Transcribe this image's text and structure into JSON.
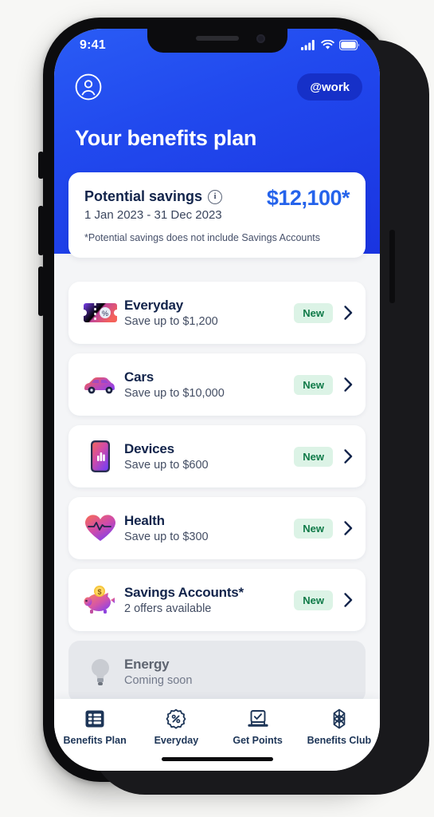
{
  "status_bar": {
    "time": "9:41",
    "signal_icon": "cellular-signal-icon",
    "wifi_icon": "wifi-icon",
    "battery_icon": "battery-icon"
  },
  "header": {
    "avatar_icon": "profile-avatar-icon",
    "workspace_badge": "@work",
    "title": "Your benefits plan",
    "background_color": "#2149ee"
  },
  "savings_card": {
    "label": "Potential savings",
    "info_icon": "info-icon",
    "amount": "$12,100*",
    "amount_color": "#2563eb",
    "date_range": "1 Jan 2023  -  31 Dec 2023",
    "disclaimer": "*Potential savings does not include Savings Accounts"
  },
  "benefits": [
    {
      "icon": "coupon-ticket-icon",
      "title": "Everyday",
      "subtitle": "Save up to $1,200",
      "badge": "New",
      "chevron_icon": "chevron-right-icon",
      "disabled": false
    },
    {
      "icon": "car-icon",
      "title": "Cars",
      "subtitle": "Save up to $10,000",
      "badge": "New",
      "chevron_icon": "chevron-right-icon",
      "disabled": false
    },
    {
      "icon": "mobile-phone-icon",
      "title": "Devices",
      "subtitle": "Save up to $600",
      "badge": "New",
      "chevron_icon": "chevron-right-icon",
      "disabled": false
    },
    {
      "icon": "heart-pulse-icon",
      "title": "Health",
      "subtitle": "Save up to $300",
      "badge": "New",
      "chevron_icon": "chevron-right-icon",
      "disabled": false
    },
    {
      "icon": "piggy-bank-icon",
      "title": "Savings Accounts*",
      "subtitle": "2 offers available",
      "badge": "New",
      "chevron_icon": "chevron-right-icon",
      "disabled": false
    },
    {
      "icon": "lightbulb-icon",
      "title": "Energy",
      "subtitle": "Coming soon",
      "badge": "",
      "chevron_icon": "",
      "disabled": true
    }
  ],
  "badge_colors": {
    "background": "#dcf3e6",
    "text": "#0f7a48"
  },
  "tabbar": {
    "active_index": 0,
    "tabs": [
      {
        "label": "Benefits Plan",
        "icon": "list-grid-icon"
      },
      {
        "label": "Everyday",
        "icon": "percent-badge-icon"
      },
      {
        "label": "Get Points",
        "icon": "laptop-check-icon"
      },
      {
        "label": "Benefits Club",
        "icon": "snowflake-icon"
      }
    ]
  }
}
